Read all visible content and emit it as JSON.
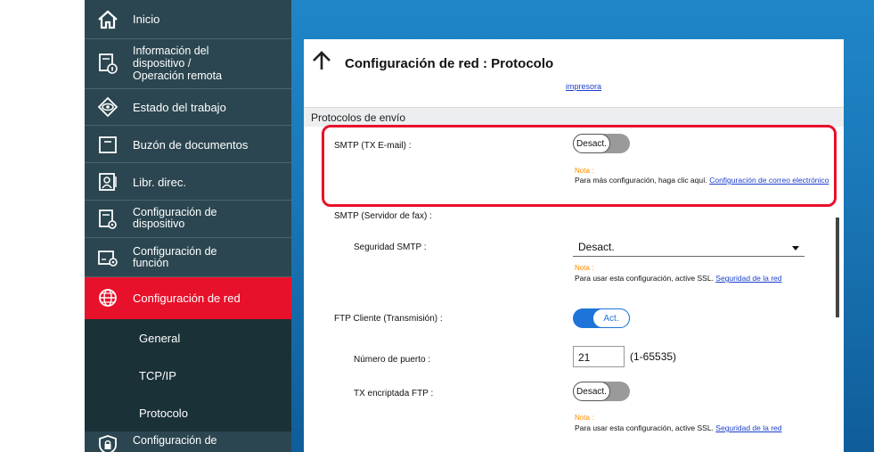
{
  "sidebar": {
    "items": [
      {
        "label": "Inicio",
        "icon": "home-icon"
      },
      {
        "label": "Información del\ndispositivo /\nOperación remota",
        "icon": "device-info-icon"
      },
      {
        "label": "Estado del trabajo",
        "icon": "eye-icon"
      },
      {
        "label": "Buzón de documentos",
        "icon": "folder-icon"
      },
      {
        "label": "Libr. direc.",
        "icon": "address-book-icon"
      },
      {
        "label": "Configuración de\ndispositivo",
        "icon": "device-settings-icon"
      },
      {
        "label": "Configuración de\nfunción",
        "icon": "function-settings-icon"
      },
      {
        "label": "Configuración de red",
        "icon": "globe-icon"
      },
      {
        "label": "Configuración de",
        "icon": "security-shield-icon"
      }
    ],
    "subitems": [
      {
        "label": "General"
      },
      {
        "label": "TCP/IP"
      },
      {
        "label": "Protocolo"
      }
    ]
  },
  "panel": {
    "title": "Configuración de red : Protocolo",
    "top_link": "impresora",
    "section": "Protocolos de envío",
    "smtp_tx": {
      "label": "SMTP (TX E-mail) :",
      "toggle": "Desact.",
      "note": "Nota :",
      "help": "Para más configuración, haga clic aquí.",
      "link": "Configuración de correo electrónico"
    },
    "smtp_fax": {
      "label": "SMTP (Servidor de fax) :"
    },
    "smtp_security": {
      "label": "Seguridad SMTP :",
      "value": "Desact.",
      "note": "Nota :",
      "help": "Para usar esta configuración, active SSL.",
      "link": "Seguridad de la red"
    },
    "ftp_client": {
      "label": "FTP Cliente (Transmisión) :",
      "toggle": "Act."
    },
    "port": {
      "label": "Número de puerto :",
      "value": "21",
      "range": "(1-65535)"
    },
    "ftp_encrypted": {
      "label": "TX encriptada FTP :",
      "toggle": "Desact.",
      "note": "Nota :",
      "help": "Para usar esta configuración, active SSL.",
      "link": "Seguridad de la red"
    }
  },
  "colors": {
    "sidebar_bg": "#2b4650",
    "active_red": "#e8112b",
    "toggle_on": "#1e74d8",
    "note_orange": "#ff8c00",
    "link_blue": "#1a3fcc"
  }
}
